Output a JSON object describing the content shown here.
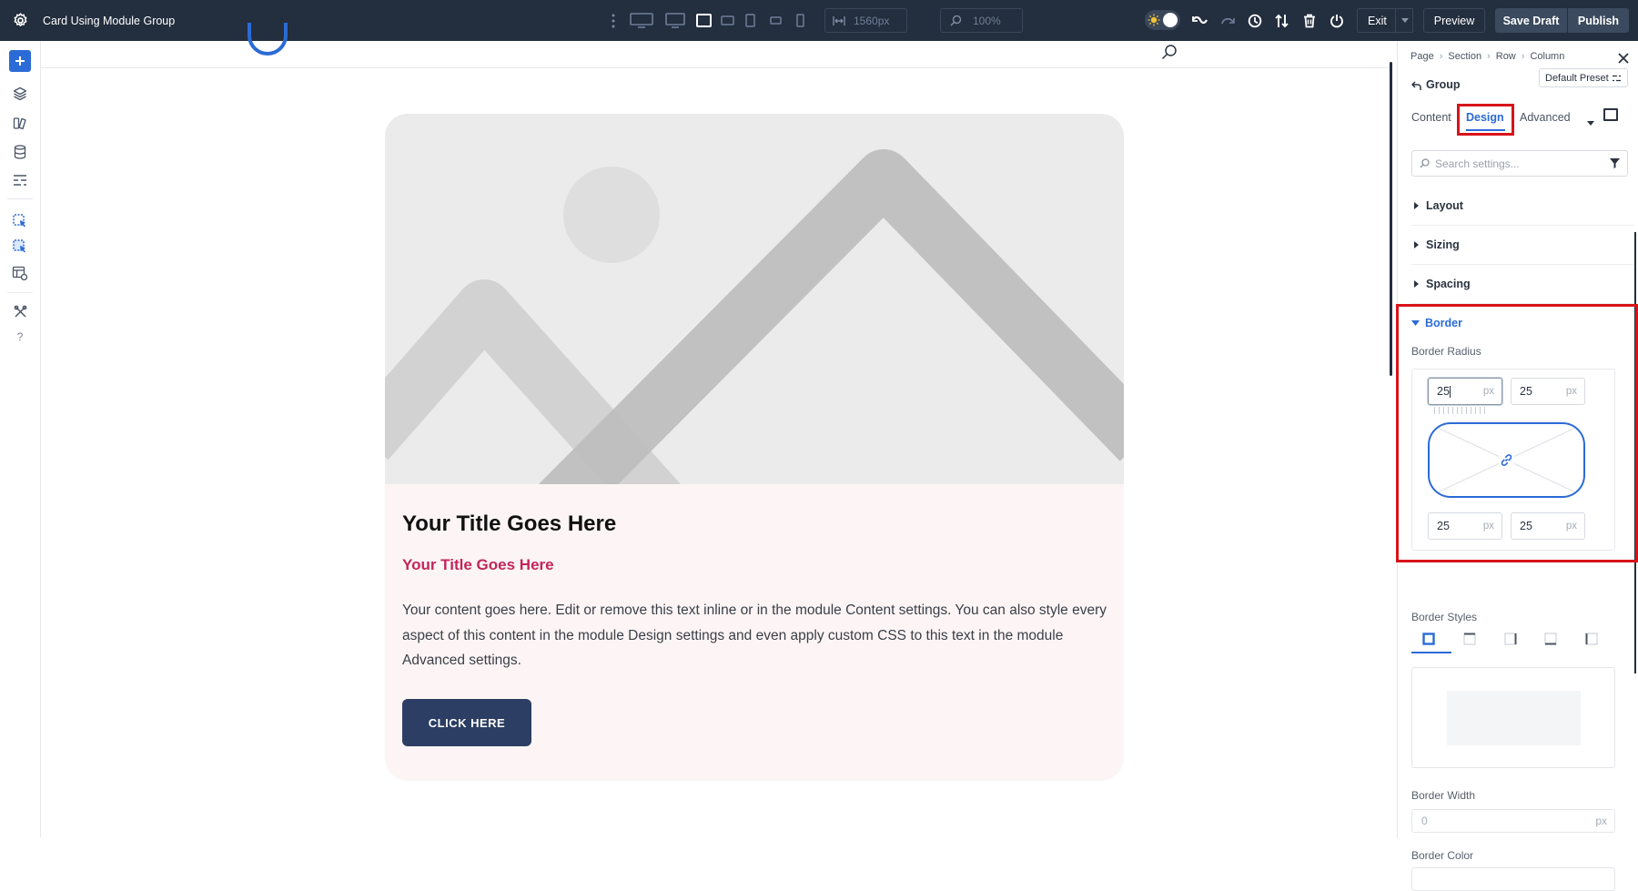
{
  "topbar": {
    "title": "Card Using Module Group",
    "width_value": "1560px",
    "zoom_value": "100%",
    "exit_label": "Exit",
    "preview_label": "Preview",
    "save_draft_label": "Save Draft",
    "publish_label": "Publish",
    "device_icons": [
      "desktop-wide-icon",
      "desktop-icon",
      "laptop-icon",
      "tablet-landscape-icon",
      "tablet-icon",
      "phone-landscape-icon",
      "phone-icon"
    ]
  },
  "sidebar": {
    "items": [
      "add-icon",
      "layers-icon",
      "modules-icon",
      "database-icon",
      "layout-icon",
      "module-group-icon",
      "module-group-select-icon",
      "page-settings-icon",
      "tools-icon",
      "help-icon"
    ]
  },
  "card": {
    "title": "Your Title Goes Here",
    "subtitle": "Your Title Goes Here",
    "body": "Your content goes here. Edit or remove this text inline or in the module Content settings. You can also style every aspect of this content in the module Design settings and even apply custom CSS to this text in the module Advanced settings.",
    "button_label": "CLICK HERE",
    "colors": {
      "subtitle": "#c2255c",
      "button_bg": "#2c3e63",
      "card_bg": "#fdf5f5"
    }
  },
  "panel": {
    "breadcrumb": [
      "Page",
      "Section",
      "Row",
      "Column"
    ],
    "element_name": "Group",
    "preset_label": "Default Preset",
    "tabs": [
      {
        "label": "Content",
        "active": false
      },
      {
        "label": "Design",
        "active": true
      },
      {
        "label": "Advanced",
        "active": false
      }
    ],
    "search_placeholder": "Search settings...",
    "sections": [
      "Layout",
      "Sizing",
      "Spacing"
    ],
    "border": {
      "title": "Border",
      "radius_label": "Border Radius",
      "radius": {
        "top_left": "25",
        "top_right": "25",
        "bottom_left": "25",
        "bottom_right": "25"
      },
      "unit": "px",
      "styles_label": "Border Styles",
      "style_icons": [
        "border-all-icon",
        "border-top-icon",
        "border-right-icon",
        "border-bottom-icon",
        "border-left-icon"
      ],
      "width_label": "Border Width",
      "width_value": "0",
      "color_label": "Border Color"
    },
    "accent": "#2b6bd6",
    "highlight": "#d7141a"
  }
}
